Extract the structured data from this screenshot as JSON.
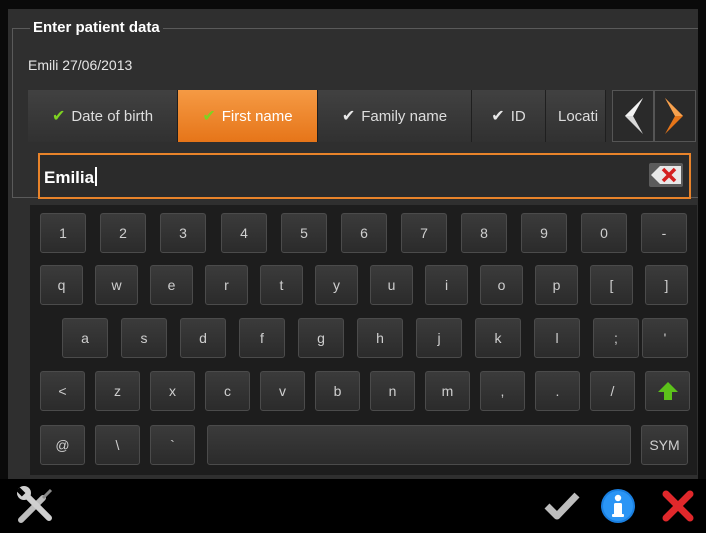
{
  "panel": {
    "legend": "Enter patient data",
    "summary": "Emili 27/06/2013"
  },
  "tabs": [
    {
      "label": "Date of birth",
      "check": "green-check-icon",
      "active": false
    },
    {
      "label": "First name",
      "check": "green-check-icon",
      "active": true
    },
    {
      "label": "Family name",
      "check": "white-check-icon",
      "active": false
    },
    {
      "label": "ID",
      "check": "white-check-icon",
      "active": false
    },
    {
      "label": "Locati",
      "check": "",
      "active": false
    }
  ],
  "input": {
    "value": "Emilia"
  },
  "keyboard": {
    "row1": [
      "1",
      "2",
      "3",
      "4",
      "5",
      "6",
      "7",
      "8",
      "9",
      "0",
      "-"
    ],
    "row2": [
      "q",
      "w",
      "e",
      "r",
      "t",
      "y",
      "u",
      "i",
      "o",
      "p",
      "[",
      "]"
    ],
    "row3": [
      "a",
      "s",
      "d",
      "f",
      "g",
      "h",
      "j",
      "k",
      "l",
      ";",
      "'"
    ],
    "row4": [
      "<",
      "z",
      "x",
      "c",
      "v",
      "b",
      "n",
      "m",
      ",",
      ".",
      "/"
    ],
    "row5": {
      "at": "@",
      "backslash": "\\",
      "backtick": "`",
      "sym": "SYM"
    }
  },
  "colors": {
    "accent": "#e8832a",
    "check_green": "#7ed321",
    "shift_green": "#5cc21a",
    "close_red": "#e0282b",
    "info_blue": "#1a7fe0"
  },
  "icons": {
    "settings": "wrench-screwdriver-icon",
    "confirm": "check-icon",
    "info": "info-icon",
    "close": "close-icon",
    "shift": "shift-up-arrow-icon",
    "clear": "backspace-clear-icon"
  }
}
